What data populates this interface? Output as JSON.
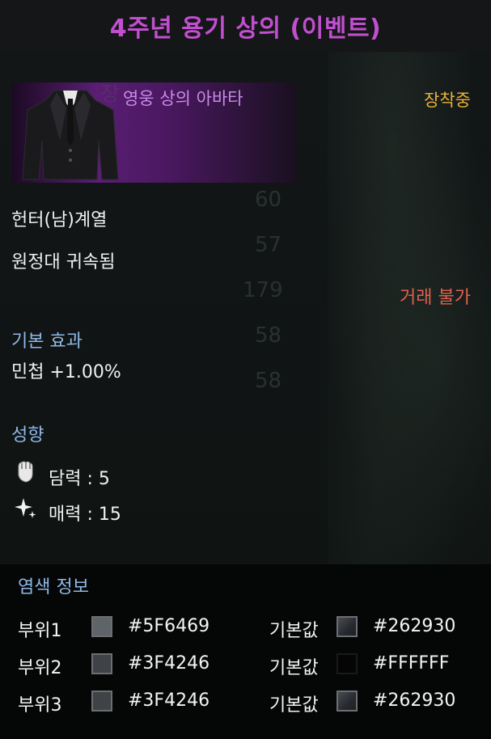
{
  "title": "4주년 용기 상의 (이벤트)",
  "colors": {
    "title": "#c24ed0",
    "avatar_label": "#c98ae6",
    "equipped": "#e8b23a",
    "section": "#8fb9e6",
    "untradable": "#e0604e"
  },
  "item": {
    "avatar_label": "영웅 상의 아바타",
    "equipped": "장착중",
    "class_restriction": "헌터(남)계열",
    "binding": "원정대 귀속됨",
    "trade": "거래 불가"
  },
  "base_effect": {
    "header": "기본 효과",
    "value": "민첩 +1.00%"
  },
  "disposition": {
    "header": "성향",
    "items": [
      {
        "icon": "fist-icon",
        "text": "담력 : 5"
      },
      {
        "icon": "sparkle-icon",
        "text": "매력 : 15"
      }
    ]
  },
  "dye": {
    "header": "염색 정보",
    "rows": [
      {
        "part": "부위1",
        "color": "#5F6469",
        "default_label": "기본값",
        "default_color": "#262930"
      },
      {
        "part": "부위2",
        "color": "#3F4246",
        "default_label": "기본값",
        "default_color": "#FFFFFF",
        "default_text": "#FFFFFF"
      },
      {
        "part": "부위3",
        "color": "#3F4246",
        "default_label": "기본값",
        "default_color": "#262930"
      }
    ]
  }
}
